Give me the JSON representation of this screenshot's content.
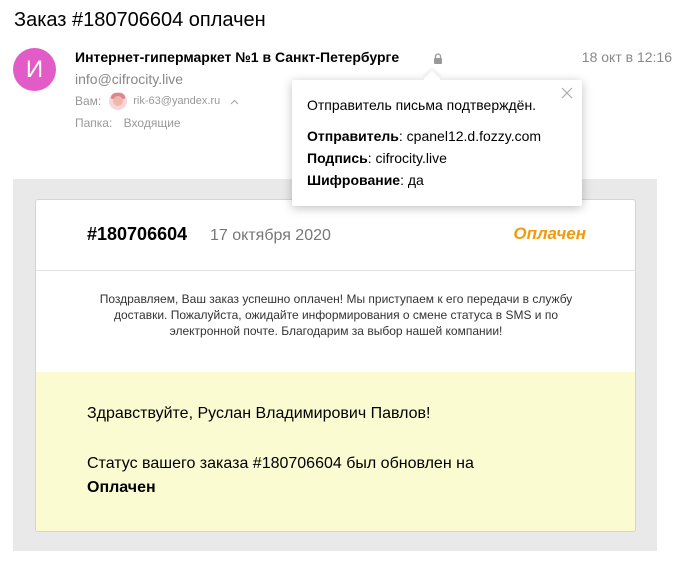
{
  "email": {
    "subject": "Заказ #180706604 оплачен",
    "avatar_letter": "И",
    "sender_name": "Интернет-гипермаркет №1 в Санкт-Петербурге",
    "sender_email": "info@cifrocity.live",
    "date": "18 окт в 12:16",
    "to_label": "Вам:",
    "to_email": "rik-63@yandex.ru",
    "folder_label": "Папка:",
    "folder_value": "Входящие"
  },
  "popup": {
    "title": "Отправитель письма подтверждён.",
    "sender_label": "Отправитель",
    "sender_value": ": cpanel12.d.fozzy.com",
    "signature_label": "Подпись",
    "signature_value": ": cifrocity.live",
    "encryption_label": "Шифрование",
    "encryption_value": ": да"
  },
  "order": {
    "number": "#180706604",
    "date": "17 октября 2020",
    "status": "Оплачен",
    "status_color": "#f39a0a",
    "congrats_text": "Поздравляем, Ваш заказ успешно оплачен! Мы приступаем к его передачи в службу доставки. Пожалуйста, ожидайте информирования о смене статуса в SMS и по электронной почте. Благодарим за выбор нашей компании!",
    "greeting": "Здравствуйте, Руслан Владимирович Павлов!",
    "status_line_prefix": "Статус вашего заказа #180706604 был обновлен на",
    "status_line_value": "Оплачен"
  },
  "colors": {
    "avatar_bg": "#e35bc7",
    "yellow_block": "#fbfbd2",
    "email_bg": "#e9e9e9"
  },
  "icons": {
    "lock": "lock-icon",
    "close": "close-icon",
    "chevron": "chevron-up-icon"
  }
}
